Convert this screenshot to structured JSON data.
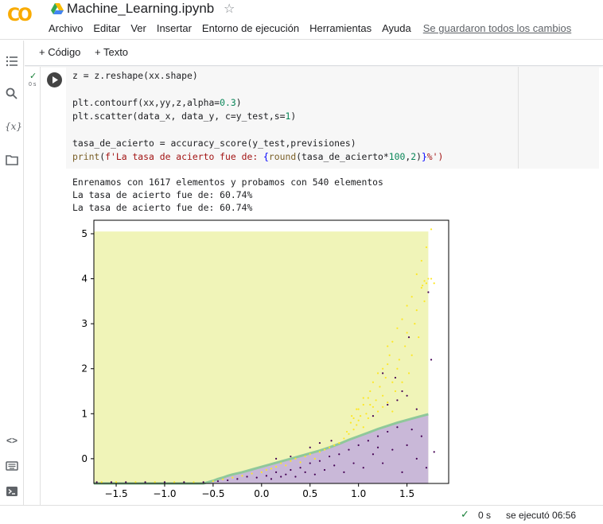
{
  "app": {
    "logo": "CO",
    "doc_title": "Machine_Learning.ipynb"
  },
  "menu": {
    "items": [
      "Archivo",
      "Editar",
      "Ver",
      "Insertar",
      "Entorno de ejecución",
      "Herramientas",
      "Ayuda"
    ],
    "saved_status": "Se guardaron todos los cambios"
  },
  "toolbar": {
    "add_code": "+ Código",
    "add_text": "+ Texto"
  },
  "sidebar": {
    "icons": [
      "table-of-contents-icon",
      "search-icon",
      "variables-icon",
      "files-icon",
      "code-snippets-icon",
      "command-palette-icon",
      "terminal-icon"
    ],
    "variables_glyph": "{x}",
    "code_glyph": "<>"
  },
  "cell": {
    "exec_time": "0 s",
    "code_lines": [
      [
        {
          "t": "z = z.reshape(xx.shape)",
          "c": ""
        }
      ],
      [
        {
          "t": "",
          "c": ""
        }
      ],
      [
        {
          "t": "plt.contourf(xx,yy,z,alpha=",
          "c": ""
        },
        {
          "t": "0.3",
          "c": "num"
        },
        {
          "t": ")",
          "c": ""
        }
      ],
      [
        {
          "t": "plt.scatter(data_x, data_y, c=y_test,s=",
          "c": ""
        },
        {
          "t": "1",
          "c": "num"
        },
        {
          "t": ")",
          "c": ""
        }
      ],
      [
        {
          "t": "",
          "c": ""
        }
      ],
      [
        {
          "t": "tasa_de_acierto = accuracy_score(y_test,previsiones)",
          "c": ""
        }
      ],
      [
        {
          "t": "print",
          "c": "fn"
        },
        {
          "t": "(",
          "c": ""
        },
        {
          "t": "f'La tasa de acierto fue de: ",
          "c": "str"
        },
        {
          "t": "{",
          "c": "tpl"
        },
        {
          "t": "round",
          "c": "fn"
        },
        {
          "t": "(tasa_de_acierto*",
          "c": ""
        },
        {
          "t": "100",
          "c": "num"
        },
        {
          "t": ",",
          "c": ""
        },
        {
          "t": "2",
          "c": "num"
        },
        {
          "t": ")",
          "c": ""
        },
        {
          "t": "}",
          "c": "tpl"
        },
        {
          "t": "%')",
          "c": "str"
        }
      ]
    ],
    "output_lines": [
      "Enrenamos con 1617 elementos y probamos con 540 elementos",
      "La tasa de acierto fue de: 60.74%",
      "La tasa de acierto fue de: 60.74%"
    ]
  },
  "chart_data": {
    "type": "scatter",
    "xlim": [
      -1.73,
      1.93
    ],
    "ylim": [
      -0.55,
      5.3
    ],
    "xticks": [
      "−1.5",
      "−1.0",
      "−0.5",
      "0.0",
      "0.5",
      "1.0",
      "1.5"
    ],
    "xtick_values": [
      -1.5,
      -1.0,
      -0.5,
      0.0,
      0.5,
      1.0,
      1.5
    ],
    "yticks": [
      "0",
      "1",
      "2",
      "3",
      "4",
      "5"
    ],
    "ytick_values": [
      0,
      1,
      2,
      3,
      4,
      5
    ],
    "contour_extent": {
      "x": [
        -1.73,
        1.72
      ],
      "y": [
        -0.55,
        5.05
      ]
    },
    "decision_boundary": {
      "x": [
        -1.73,
        -0.6,
        -0.55,
        -0.5,
        -0.45,
        -0.4,
        -0.35,
        -0.3,
        -0.2,
        -0.1,
        0.0,
        0.1,
        0.2,
        0.3,
        0.4,
        0.5,
        0.6,
        0.7,
        0.8,
        0.9,
        1.0,
        1.1,
        1.2,
        1.3,
        1.4,
        1.5,
        1.6,
        1.72
      ],
      "y": [
        -0.55,
        -0.55,
        -0.52,
        -0.49,
        -0.45,
        -0.42,
        -0.38,
        -0.35,
        -0.3,
        -0.24,
        -0.18,
        -0.12,
        -0.06,
        0.0,
        0.06,
        0.12,
        0.18,
        0.25,
        0.33,
        0.42,
        0.5,
        0.58,
        0.66,
        0.73,
        0.8,
        0.86,
        0.92,
        0.99
      ]
    },
    "region_colors": {
      "above": "#f0f4b8",
      "below": "#c9b8d8",
      "boundary": "#8fc89a"
    },
    "classes": [
      {
        "name": "0",
        "color": "#440154"
      },
      {
        "name": "1",
        "color": "#fde725"
      }
    ],
    "points_class1": [
      [
        -1.65,
        -0.52
      ],
      [
        -1.5,
        -0.52
      ],
      [
        -1.3,
        -0.52
      ],
      [
        -1.1,
        -0.52
      ],
      [
        -0.9,
        -0.52
      ],
      [
        -0.7,
        -0.52
      ],
      [
        -0.5,
        -0.5
      ],
      [
        -0.4,
        -0.46
      ],
      [
        -0.3,
        -0.42
      ],
      [
        -0.2,
        -0.38
      ],
      [
        -0.1,
        -0.33
      ],
      [
        0.0,
        -0.3
      ],
      [
        0.05,
        -0.25
      ],
      [
        0.1,
        -0.22
      ],
      [
        0.15,
        -0.18
      ],
      [
        0.2,
        -0.1
      ],
      [
        0.25,
        -0.15
      ],
      [
        0.3,
        -0.05
      ],
      [
        0.35,
        0.0
      ],
      [
        0.4,
        -0.08
      ],
      [
        0.45,
        0.05
      ],
      [
        0.5,
        0.1
      ],
      [
        0.55,
        0.0
      ],
      [
        0.6,
        0.15
      ],
      [
        0.65,
        0.2
      ],
      [
        0.7,
        0.25
      ],
      [
        0.75,
        0.3
      ],
      [
        0.8,
        0.35
      ],
      [
        0.85,
        0.45
      ],
      [
        0.88,
        0.6
      ],
      [
        0.9,
        0.55
      ],
      [
        0.92,
        0.8
      ],
      [
        0.95,
        0.65
      ],
      [
        0.95,
        0.9
      ],
      [
        0.98,
        0.75
      ],
      [
        1.0,
        0.85
      ],
      [
        1.0,
        1.1
      ],
      [
        1.02,
        0.95
      ],
      [
        1.05,
        1.2
      ],
      [
        1.05,
        0.7
      ],
      [
        1.08,
        1.0
      ],
      [
        1.1,
        1.35
      ],
      [
        1.1,
        0.9
      ],
      [
        1.12,
        1.5
      ],
      [
        1.15,
        1.15
      ],
      [
        1.15,
        1.7
      ],
      [
        1.18,
        1.3
      ],
      [
        1.2,
        1.9
      ],
      [
        1.2,
        1.05
      ],
      [
        1.22,
        1.6
      ],
      [
        1.25,
        2.0
      ],
      [
        1.25,
        1.4
      ],
      [
        1.28,
        1.8
      ],
      [
        1.3,
        2.1
      ],
      [
        1.3,
        1.25
      ],
      [
        1.32,
        2.3
      ],
      [
        1.35,
        1.7
      ],
      [
        1.35,
        2.6
      ],
      [
        1.38,
        1.5
      ],
      [
        1.4,
        2.9
      ],
      [
        1.4,
        2.0
      ],
      [
        1.42,
        2.2
      ],
      [
        1.45,
        3.1
      ],
      [
        1.45,
        1.7
      ],
      [
        1.48,
        2.5
      ],
      [
        1.5,
        3.4
      ],
      [
        1.5,
        2.8
      ],
      [
        1.52,
        1.9
      ],
      [
        1.55,
        3.6
      ],
      [
        1.55,
        2.3
      ],
      [
        1.58,
        3.0
      ],
      [
        1.6,
        4.1
      ],
      [
        1.6,
        3.3
      ],
      [
        1.62,
        2.7
      ],
      [
        1.65,
        4.4
      ],
      [
        1.65,
        3.8
      ],
      [
        1.68,
        3.5
      ],
      [
        1.7,
        4.7
      ],
      [
        1.7,
        3.9
      ],
      [
        1.72,
        4.0
      ],
      [
        1.75,
        5.1
      ],
      [
        1.75,
        4.0
      ],
      [
        1.78,
        3.9
      ],
      [
        1.68,
        3.95
      ],
      [
        1.66,
        3.85
      ],
      [
        1.05,
        1.35
      ],
      [
        0.98,
        1.1
      ],
      [
        0.93,
        0.95
      ],
      [
        1.25,
        1.15
      ],
      [
        1.35,
        1.05
      ],
      [
        1.3,
        2.5
      ],
      [
        1.12,
        1.2
      ]
    ],
    "points_class0": [
      [
        -1.7,
        -0.52
      ],
      [
        -1.55,
        -0.52
      ],
      [
        -1.4,
        -0.52
      ],
      [
        -1.2,
        -0.52
      ],
      [
        -1.0,
        -0.52
      ],
      [
        -0.8,
        -0.52
      ],
      [
        -0.6,
        -0.52
      ],
      [
        -0.45,
        -0.5
      ],
      [
        -0.35,
        -0.48
      ],
      [
        -0.25,
        -0.45
      ],
      [
        -0.15,
        -0.4
      ],
      [
        -0.05,
        -0.42
      ],
      [
        0.05,
        -0.38
      ],
      [
        0.1,
        -0.45
      ],
      [
        0.15,
        -0.3
      ],
      [
        0.2,
        -0.4
      ],
      [
        0.25,
        -0.35
      ],
      [
        0.3,
        -0.25
      ],
      [
        0.35,
        -0.4
      ],
      [
        0.4,
        -0.2
      ],
      [
        0.45,
        -0.3
      ],
      [
        0.5,
        -0.1
      ],
      [
        0.55,
        -0.35
      ],
      [
        0.6,
        -0.05
      ],
      [
        0.65,
        -0.25
      ],
      [
        0.7,
        0.05
      ],
      [
        0.75,
        -0.15
      ],
      [
        0.8,
        0.1
      ],
      [
        0.85,
        -0.3
      ],
      [
        0.9,
        0.2
      ],
      [
        0.95,
        -0.1
      ],
      [
        1.0,
        0.3
      ],
      [
        1.05,
        -0.2
      ],
      [
        1.1,
        0.4
      ],
      [
        1.15,
        0.1
      ],
      [
        1.2,
        0.5
      ],
      [
        1.25,
        -0.1
      ],
      [
        1.3,
        0.6
      ],
      [
        1.35,
        0.2
      ],
      [
        1.4,
        0.7
      ],
      [
        1.45,
        -0.3
      ],
      [
        1.5,
        0.3
      ],
      [
        1.55,
        0.65
      ],
      [
        1.6,
        0.0
      ],
      [
        1.65,
        0.5
      ],
      [
        1.7,
        -0.2
      ],
      [
        1.75,
        2.2
      ],
      [
        1.78,
        0.15
      ],
      [
        1.3,
        1.2
      ],
      [
        1.4,
        1.3
      ],
      [
        1.45,
        1.5
      ],
      [
        1.5,
        1.4
      ],
      [
        1.52,
        2.7
      ],
      [
        1.38,
        1.8
      ],
      [
        1.72,
        3.7
      ],
      [
        1.15,
        0.95
      ],
      [
        1.25,
        1.9
      ],
      [
        0.5,
        0.25
      ],
      [
        0.6,
        0.35
      ],
      [
        0.72,
        0.4
      ],
      [
        0.3,
        0.05
      ],
      [
        0.15,
        0.0
      ],
      [
        1.6,
        1.1
      ],
      [
        1.2,
        0.25
      ]
    ]
  },
  "status": {
    "time": "0 s",
    "executed": "se ejecutó 06:56"
  }
}
